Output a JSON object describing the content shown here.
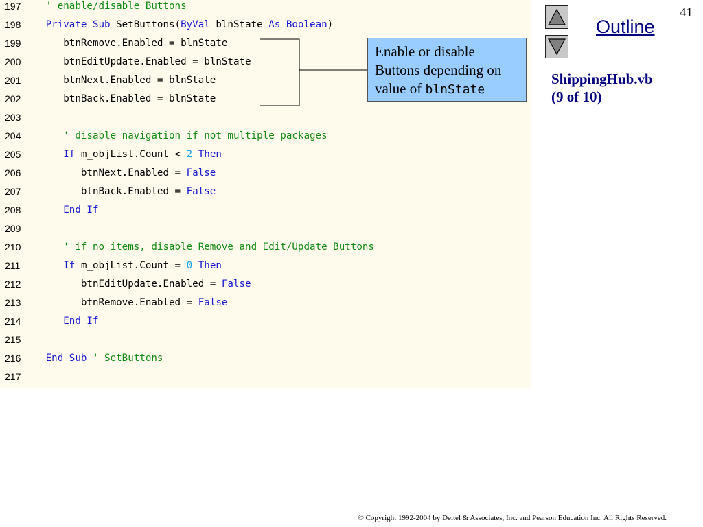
{
  "slide": {
    "number": "41",
    "outline_label": "Outline",
    "file_title": "ShippingHub.vb",
    "file_subtitle": "(9 of 10)"
  },
  "callout": {
    "line1": "Enable or disable",
    "line2": "Buttons depending on",
    "line3_prefix": "value of ",
    "line3_code": "blnState"
  },
  "code": [
    {
      "ln": "197",
      "tokens": [
        {
          "t": "   "
        },
        {
          "t": "' enable/disable Buttons",
          "c": "cm"
        }
      ]
    },
    {
      "ln": "198",
      "tokens": [
        {
          "t": "   "
        },
        {
          "t": "Private",
          "c": "kw"
        },
        {
          "t": " "
        },
        {
          "t": "Sub",
          "c": "kw"
        },
        {
          "t": " SetButtons("
        },
        {
          "t": "ByVal",
          "c": "kw"
        },
        {
          "t": " blnState "
        },
        {
          "t": "As",
          "c": "kw"
        },
        {
          "t": " "
        },
        {
          "t": "Boolean",
          "c": "kw"
        },
        {
          "t": ")"
        }
      ]
    },
    {
      "ln": "199",
      "tokens": [
        {
          "t": "      btnRemove.Enabled = blnState"
        }
      ]
    },
    {
      "ln": "200",
      "tokens": [
        {
          "t": "      btnEditUpdate.Enabled = blnState"
        }
      ]
    },
    {
      "ln": "201",
      "tokens": [
        {
          "t": "      btnNext.Enabled = blnState"
        }
      ]
    },
    {
      "ln": "202",
      "tokens": [
        {
          "t": "      btnBack.Enabled = blnState"
        }
      ]
    },
    {
      "ln": "203",
      "tokens": []
    },
    {
      "ln": "204",
      "tokens": [
        {
          "t": "      "
        },
        {
          "t": "' disable navigation if not multiple packages",
          "c": "cm"
        }
      ]
    },
    {
      "ln": "205",
      "tokens": [
        {
          "t": "      "
        },
        {
          "t": "If",
          "c": "kw"
        },
        {
          "t": " m_objList.Count < "
        },
        {
          "t": "2",
          "c": "num"
        },
        {
          "t": " "
        },
        {
          "t": "Then",
          "c": "kw"
        }
      ]
    },
    {
      "ln": "206",
      "tokens": [
        {
          "t": "         btnNext.Enabled = "
        },
        {
          "t": "False",
          "c": "kw"
        }
      ]
    },
    {
      "ln": "207",
      "tokens": [
        {
          "t": "         btnBack.Enabled = "
        },
        {
          "t": "False",
          "c": "kw"
        }
      ]
    },
    {
      "ln": "208",
      "tokens": [
        {
          "t": "      "
        },
        {
          "t": "End",
          "c": "kw"
        },
        {
          "t": " "
        },
        {
          "t": "If",
          "c": "kw"
        }
      ]
    },
    {
      "ln": "209",
      "tokens": []
    },
    {
      "ln": "210",
      "tokens": [
        {
          "t": "      "
        },
        {
          "t": "' if no items, disable Remove and Edit/Update Buttons",
          "c": "cm"
        }
      ]
    },
    {
      "ln": "211",
      "tokens": [
        {
          "t": "      "
        },
        {
          "t": "If",
          "c": "kw"
        },
        {
          "t": " m_objList.Count = "
        },
        {
          "t": "0",
          "c": "num"
        },
        {
          "t": " "
        },
        {
          "t": "Then",
          "c": "kw"
        }
      ]
    },
    {
      "ln": "212",
      "tokens": [
        {
          "t": "         btnEditUpdate.Enabled = "
        },
        {
          "t": "False",
          "c": "kw"
        }
      ]
    },
    {
      "ln": "213",
      "tokens": [
        {
          "t": "         btnRemove.Enabled = "
        },
        {
          "t": "False",
          "c": "kw"
        }
      ]
    },
    {
      "ln": "214",
      "tokens": [
        {
          "t": "      "
        },
        {
          "t": "End",
          "c": "kw"
        },
        {
          "t": " "
        },
        {
          "t": "If",
          "c": "kw"
        }
      ]
    },
    {
      "ln": "215",
      "tokens": []
    },
    {
      "ln": "216",
      "tokens": [
        {
          "t": "   "
        },
        {
          "t": "End",
          "c": "kw"
        },
        {
          "t": " "
        },
        {
          "t": "Sub",
          "c": "kw"
        },
        {
          "t": " "
        },
        {
          "t": "' SetButtons",
          "c": "cm"
        }
      ]
    },
    {
      "ln": "217",
      "tokens": []
    }
  ],
  "copyright": "© Copyright 1992-2004 by Deitel & Associates, Inc. and Pearson Education Inc. All Rights Reserved.",
  "nav": {
    "up_icon": "triangle-up-icon",
    "down_icon": "triangle-down-icon"
  },
  "colors": {
    "keyword": "#1a1ad0",
    "comment": "#138a13",
    "number": "#16a0e6",
    "code_bg": "#fffbec",
    "callout_bg": "#99ccff"
  }
}
